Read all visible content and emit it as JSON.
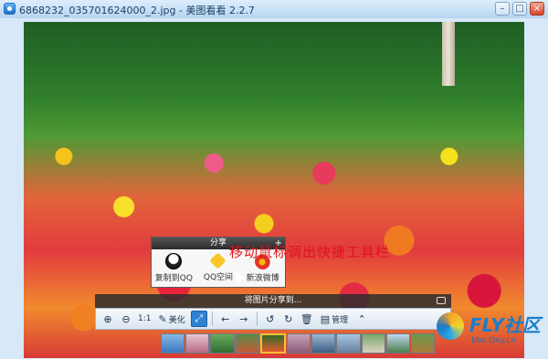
{
  "window": {
    "title": "6868232_035701624000_2.jpg - 美图看看 2.2.7"
  },
  "share_popup": {
    "header": "分享",
    "items": [
      {
        "label": "复制到QQ",
        "icon": "qq-penguin-icon"
      },
      {
        "label": "QQ空间",
        "icon": "qzone-star-icon"
      },
      {
        "label": "新浪微博",
        "icon": "weibo-icon"
      }
    ]
  },
  "overlay_hint": "移动鼠标调出快捷工具栏",
  "share_bar": {
    "text": "将图片分享到..."
  },
  "toolbar": {
    "beautify_label": "美化",
    "manage_label": "管理",
    "actual_size_label": "1:1"
  },
  "watermark": {
    "brand": "FLY社区",
    "url": "bbs.Qxy.cn"
  },
  "colors": {
    "accent": "#2f82d3",
    "hint_text": "#e0141a",
    "selected_thumb": "#f7c235"
  }
}
